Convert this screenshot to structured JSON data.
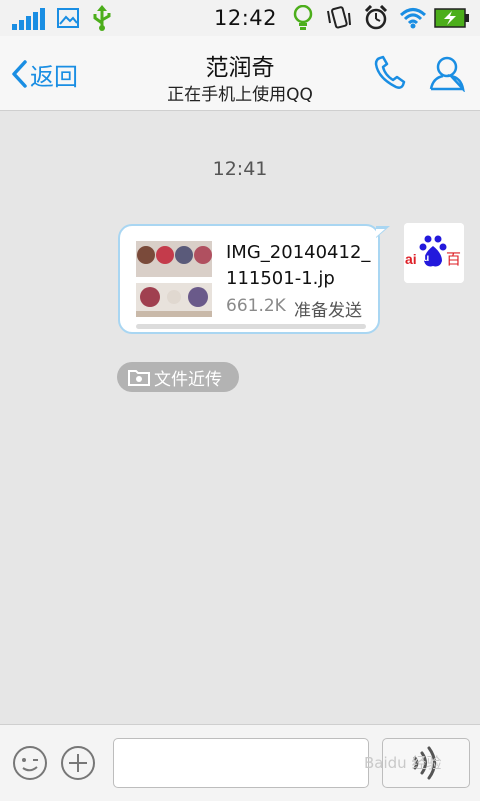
{
  "status_bar": {
    "time": "12:42",
    "icons": [
      "signal-icon",
      "image-icon",
      "usb-icon",
      "lightbulb-icon",
      "vibrate-icon",
      "alarm-icon",
      "wifi-icon",
      "battery-charging-icon"
    ]
  },
  "header": {
    "back_label": "返回",
    "title": "范润奇",
    "subtitle": "正在手机上使用QQ",
    "icons": [
      "phone-icon",
      "profile-icon"
    ]
  },
  "chat": {
    "time_separator": "12:41",
    "file_message": {
      "file_name": "IMG_20140412_111501-1.jp",
      "size": "661.2K",
      "status": "准备发送",
      "progress": 0
    },
    "avatar_text": "ai百",
    "transfer_chip_label": "文件近传"
  },
  "input_bar": {
    "message_value": "",
    "icons": [
      "emoji-icon",
      "plus-icon",
      "voice-icon"
    ]
  },
  "colors": {
    "accent": "#1a8ee3",
    "bubble_border": "#a9d6f2",
    "chip_bg": "#b3b3b3"
  },
  "watermark": "Baidu 经验"
}
